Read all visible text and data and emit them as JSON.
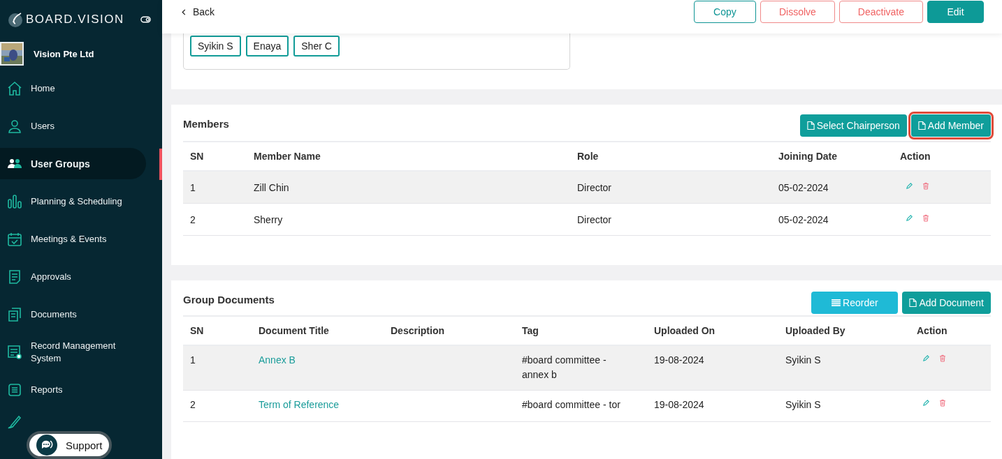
{
  "sidebar": {
    "brand": "BOARD.VISION",
    "company": "Vision Pte Ltd",
    "items": [
      {
        "label": "Home",
        "kind": "home",
        "selected": false
      },
      {
        "label": "Users",
        "kind": "user",
        "selected": false
      },
      {
        "label": "User Groups",
        "kind": "users",
        "selected": true
      },
      {
        "label": "Planning & Scheduling",
        "kind": "bars",
        "selected": false
      },
      {
        "label": "Meetings & Events",
        "kind": "calendar",
        "selected": false
      },
      {
        "label": "Approvals",
        "kind": "doc",
        "selected": false
      },
      {
        "label": "Documents",
        "kind": "docs",
        "selected": false
      },
      {
        "label": "Record Management System",
        "kind": "record",
        "selected": false
      },
      {
        "label": "Reports",
        "kind": "list",
        "selected": false
      },
      {
        "kind": "pen",
        "selected": false
      }
    ],
    "support": "Support"
  },
  "topbar": {
    "back": "Back",
    "buttons": [
      {
        "label": "Copy",
        "kind": "outline"
      },
      {
        "label": "Dissolve",
        "kind": "danger"
      },
      {
        "label": "Deactivate",
        "kind": "danger"
      },
      {
        "label": "Edit",
        "kind": "primary"
      }
    ]
  },
  "chips": [
    "Syikin S",
    "Enaya",
    "Sher C"
  ],
  "members": {
    "title": "Members",
    "buttons": [
      {
        "label": "Select Chairperson",
        "highlighted": false
      },
      {
        "label": "Add Member",
        "highlighted": true
      }
    ],
    "columns": [
      "SN",
      "Member Name",
      "Role",
      "Joining Date",
      "Action"
    ],
    "rows": [
      {
        "sn": "1",
        "name": "Zill Chin",
        "role": "Director",
        "date": "05-02-2024"
      },
      {
        "sn": "2",
        "name": "Sherry",
        "role": "Director",
        "date": "05-02-2024"
      }
    ]
  },
  "documents": {
    "title": "Group Documents",
    "buttons": [
      {
        "label": "Reorder",
        "kind": "reorder"
      },
      {
        "label": "Add Document",
        "kind": "add"
      }
    ],
    "columns": [
      "SN",
      "Document Title",
      "Description",
      "Tag",
      "Uploaded On",
      "Uploaded By",
      "Action"
    ],
    "rows": [
      {
        "sn": "1",
        "title": "Annex B",
        "tag": "#board committee - annex b",
        "uploaded_on": "19-08-2024",
        "uploaded_by": "Syikin S"
      },
      {
        "sn": "2",
        "title": "Term of Reference",
        "tag": "#board committee - tor",
        "uploaded_on": "19-08-2024",
        "uploaded_by": "Syikin S"
      }
    ]
  }
}
